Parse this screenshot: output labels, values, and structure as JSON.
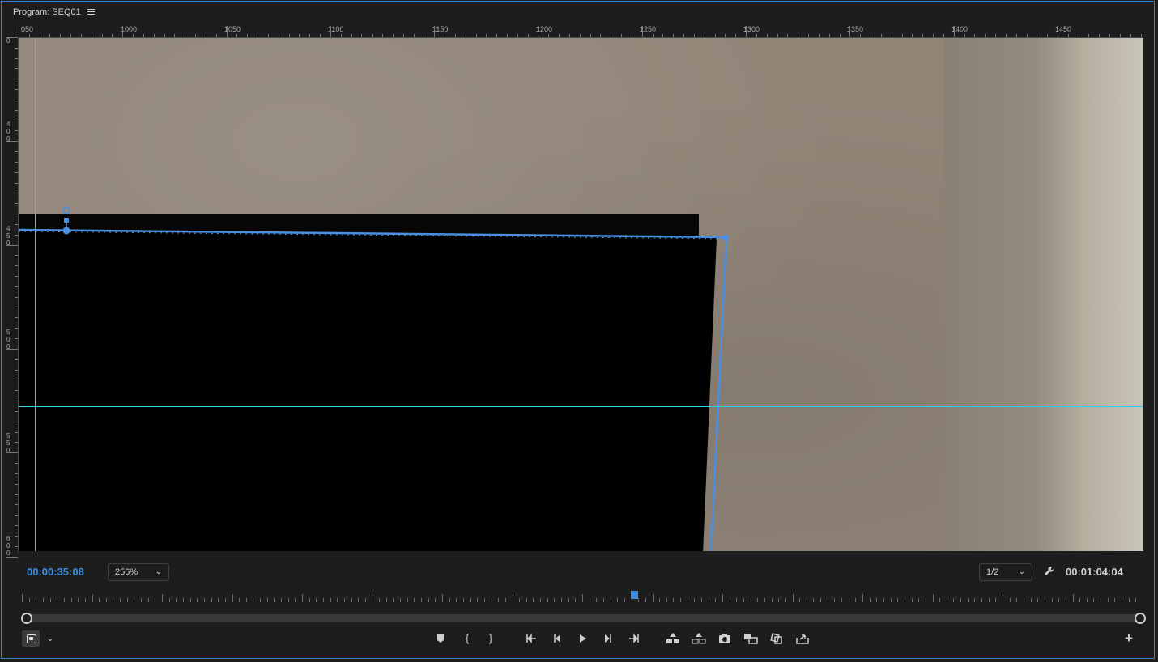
{
  "panel": {
    "title": "Program: SEQ01"
  },
  "ruler_h": {
    "labels": [
      "050",
      "1000",
      "1050",
      "1100",
      "1150",
      "1200",
      "1250",
      "1300",
      "1350",
      "1400",
      "1450"
    ]
  },
  "ruler_v": {
    "labels": [
      "0",
      "400",
      "450",
      "500",
      "550",
      "600"
    ]
  },
  "controls": {
    "current_time": "00:00:35:08",
    "zoom": "256%",
    "resolution": "1/2",
    "duration": "00:01:04:04"
  },
  "colors": {
    "accent": "#3d8fe0",
    "guide": "#29d0e8",
    "mask": "#4a90e2"
  },
  "transport_icons": [
    "add-marker-icon",
    "mark-in-icon",
    "mark-out-icon",
    "go-to-in-icon",
    "step-back-icon",
    "play-icon",
    "step-forward-icon",
    "go-to-out-icon",
    "lift-icon",
    "extract-icon",
    "export-frame-icon",
    "insert-icon",
    "overwrite-icon",
    "export-icon",
    "button-editor-icon"
  ]
}
